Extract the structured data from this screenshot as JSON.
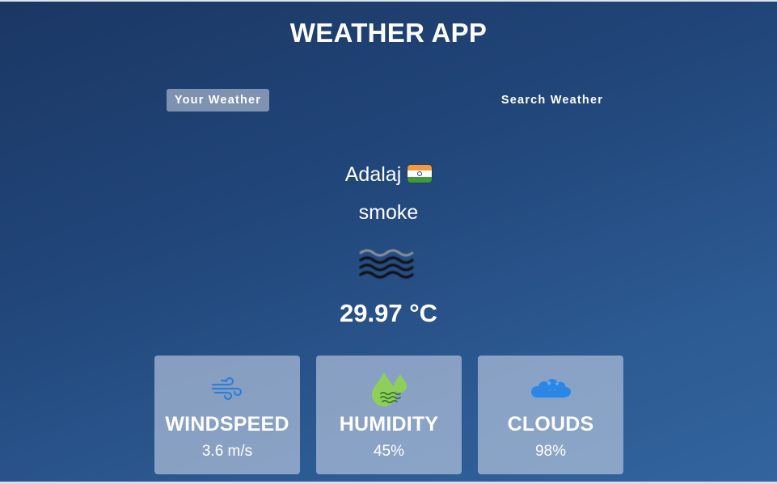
{
  "app": {
    "title": "WEATHER APP"
  },
  "tabs": [
    {
      "label": "Your Weather",
      "active": true
    },
    {
      "label": "Search Weather",
      "active": false
    }
  ],
  "location": {
    "city": "Adalaj",
    "flag_icon": "india-flag-icon"
  },
  "weather": {
    "description": "smoke",
    "icon": "smoke-haze-icon",
    "temperature": "29.97 °C"
  },
  "stats": [
    {
      "title": "WINDSPEED",
      "value": "3.6 m/s",
      "icon": "wind-icon"
    },
    {
      "title": "HUMIDITY",
      "value": "45%",
      "icon": "humidity-drops-icon"
    },
    {
      "title": "CLOUDS",
      "value": "98%",
      "icon": "cloud-icon"
    }
  ],
  "colors": {
    "background_top": "#1b3764",
    "background_bottom": "#33649d",
    "active_tab": "#a9b7cf",
    "card": "#8fa3c4",
    "wind_icon": "#2f7fd6",
    "humidity_icon": "#8ecf5a",
    "cloud_icon": "#2b86e6"
  }
}
